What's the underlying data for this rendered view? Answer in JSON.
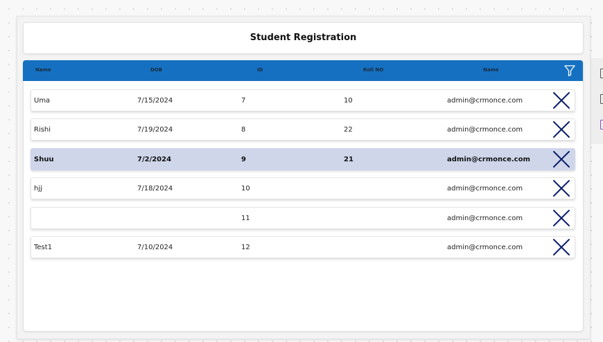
{
  "app": {
    "title": "Student Registration"
  },
  "gallery": {
    "columns": [
      "Name",
      "DOB",
      "ID",
      "Roll NO",
      "Name"
    ],
    "rows": [
      {
        "name": "Uma",
        "dob": "7/15/2024",
        "id": "7",
        "roll": "10",
        "email": "admin@crmonce.com",
        "selected": false
      },
      {
        "name": "Rishi",
        "dob": "7/19/2024",
        "id": "8",
        "roll": "22",
        "email": "admin@crmonce.com",
        "selected": false
      },
      {
        "name": "Shuu",
        "dob": "7/2/2024",
        "id": "9",
        "roll": "21",
        "email": "admin@crmonce.com",
        "selected": true
      },
      {
        "name": "hjj",
        "dob": "7/18/2024",
        "id": "10",
        "roll": "",
        "email": "admin@crmonce.com",
        "selected": false
      },
      {
        "name": "",
        "dob": "",
        "id": "11",
        "roll": "",
        "email": "admin@crmonce.com",
        "selected": false
      },
      {
        "name": "Test1",
        "dob": "7/10/2024",
        "id": "12",
        "roll": "",
        "email": "admin@crmonce.com",
        "selected": false
      }
    ]
  },
  "icons": {
    "filter": "filter-icon",
    "delete": "cancel-x-icon"
  },
  "colors": {
    "header_bar": "#1570c1",
    "selected_row": "#cfd6ea",
    "icon": "#0b1f6b"
  }
}
